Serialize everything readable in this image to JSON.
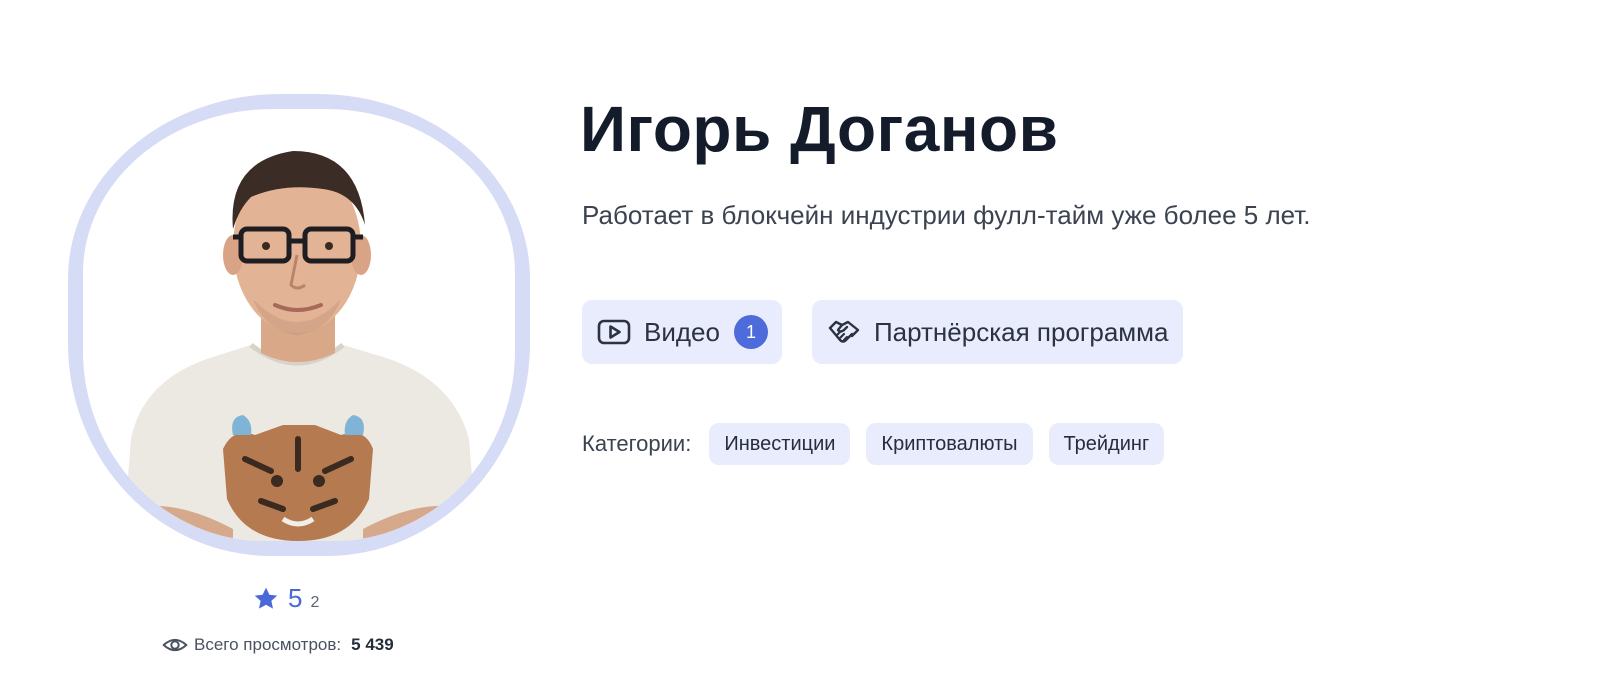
{
  "profile": {
    "name": "Игорь Доганов",
    "bio": "Работает в блокчейн индустрии фулл-тайм уже более 5 лет.",
    "avatar": {
      "frame_color": "#d6dcf6"
    }
  },
  "rating": {
    "value": "5",
    "count": "2",
    "icon": "star-icon",
    "color": "#4a68d8"
  },
  "views": {
    "label": "Всего просмотров:",
    "count": "5 439",
    "icon": "eye-icon"
  },
  "actions": {
    "video": {
      "label": "Видео",
      "badge": "1",
      "icon": "play-video-icon"
    },
    "partner": {
      "label": "Партнёрская программа",
      "icon": "handshake-icon"
    }
  },
  "categories": {
    "label": "Категории:",
    "items": [
      "Инвестиции",
      "Криптовалюты",
      "Трейдинг"
    ]
  },
  "colors": {
    "accent": "#4d6bdb",
    "chip_background": "#e8ecfc",
    "title": "#141b2a"
  }
}
